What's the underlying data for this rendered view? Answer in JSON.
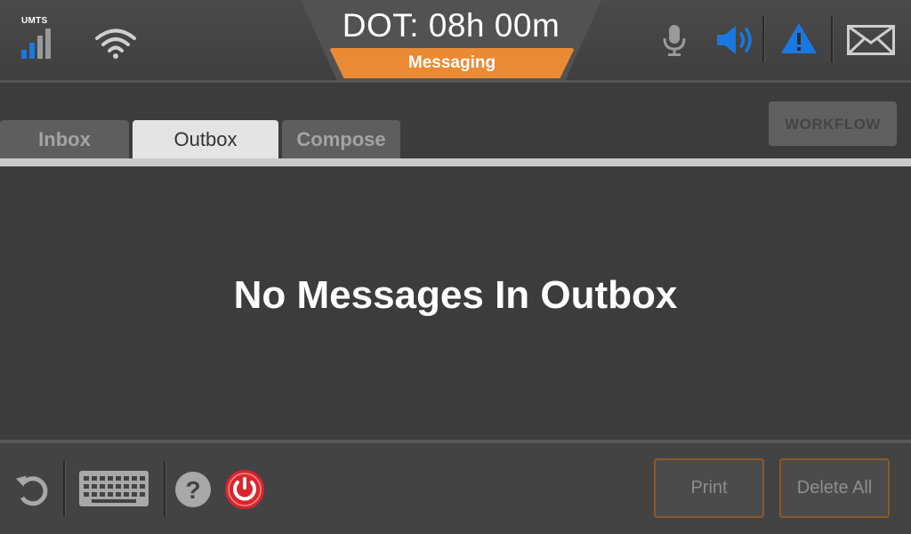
{
  "status": {
    "network_label": "UMTS",
    "network_icon": "signal-bars-icon",
    "wifi_icon": "wifi-icon"
  },
  "header": {
    "dot_text": "DOT: 08h 00m",
    "mode": "Messaging"
  },
  "top_icons": {
    "mic": "microphone-icon",
    "speaker": "speaker-icon",
    "alert": "warning-icon",
    "mail": "mail-icon"
  },
  "tabs": [
    {
      "label": "Inbox",
      "active": false
    },
    {
      "label": "Outbox",
      "active": true
    },
    {
      "label": "Compose",
      "active": false
    }
  ],
  "workflow_label": "WORKFLOW",
  "content": {
    "empty_message": "No Messages In Outbox"
  },
  "bottom": {
    "print_label": "Print",
    "delete_all_label": "Delete All"
  },
  "colors": {
    "accent_orange": "#ea8a34",
    "accent_blue": "#1a78e0",
    "power_red": "#d8262c",
    "button_border": "#8b5a2b"
  }
}
